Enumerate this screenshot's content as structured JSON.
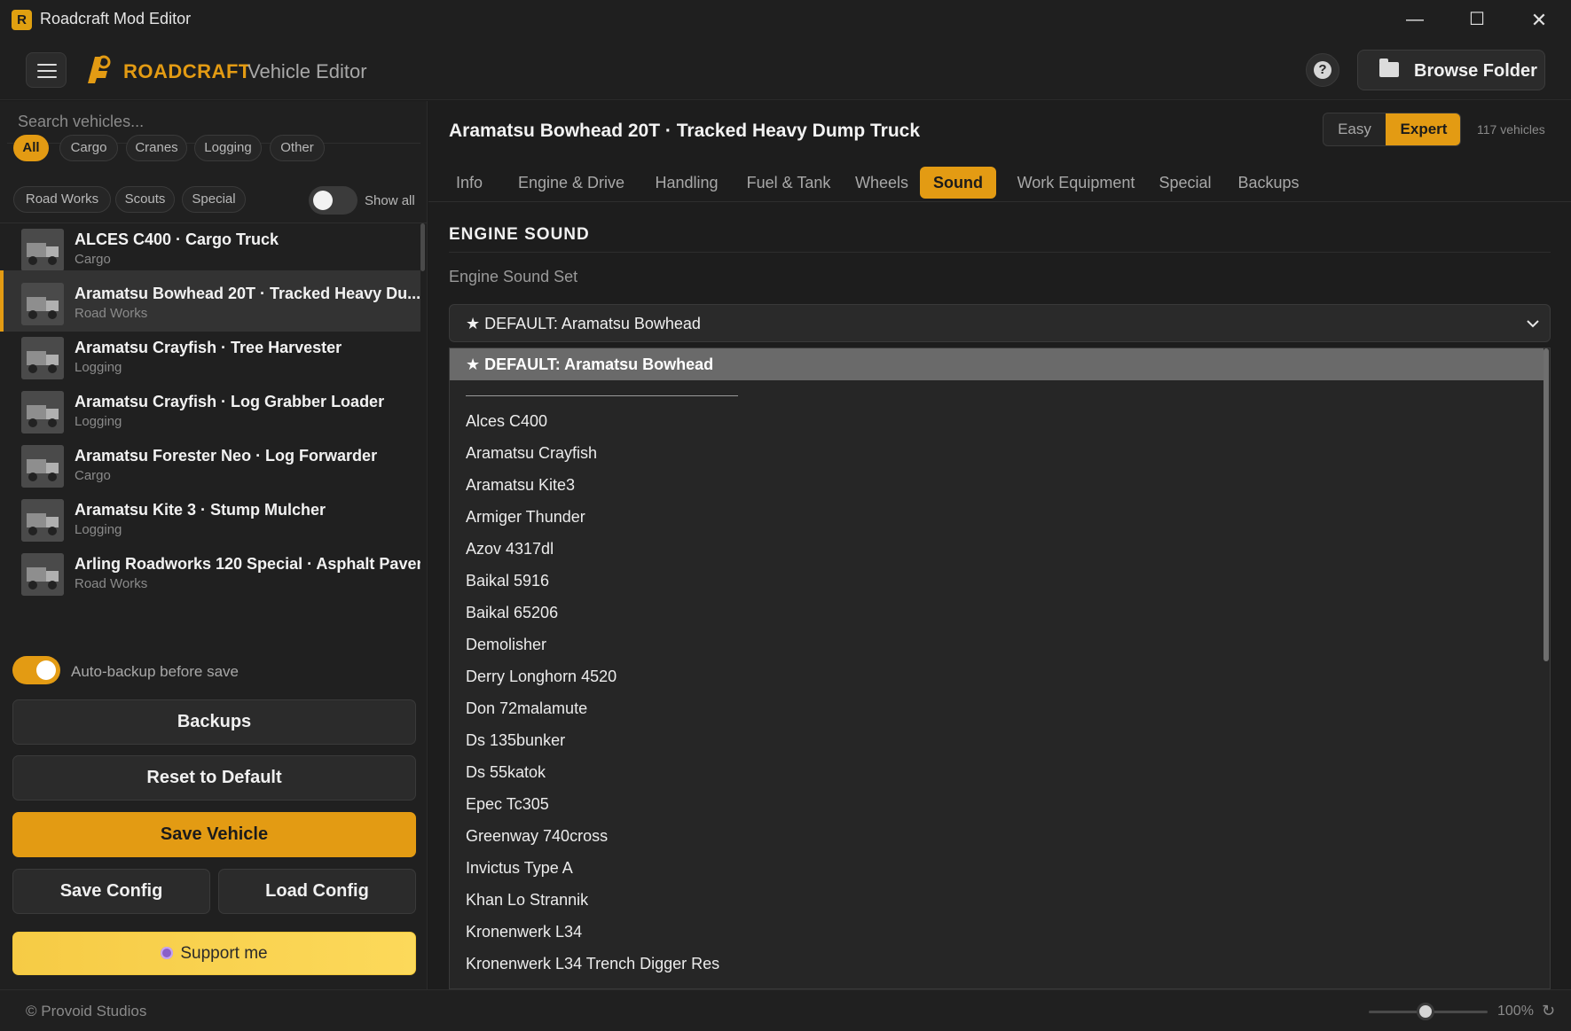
{
  "window": {
    "title": "Roadcraft Mod Editor",
    "app_icon": "R",
    "minimize": "—",
    "maximize": "☐",
    "close": "✕"
  },
  "header": {
    "brand": "ROADCRAFT",
    "subtitle": "Vehicle Editor",
    "help_label": "?",
    "browse_label": "Browse Folder"
  },
  "sidebar": {
    "search_placeholder": "Search vehicles...",
    "filters": [
      "All",
      "Cargo",
      "Cranes",
      "Logging",
      "Other",
      "Road Works",
      "Scouts",
      "Special"
    ],
    "active_filter": "All",
    "show_all_label": "Show all",
    "show_all_on": false,
    "vehicles": [
      {
        "name": "ALCES C400 · Cargo Truck",
        "category": "Cargo"
      },
      {
        "name": "Aramatsu Bowhead 20T · Tracked Heavy Du...",
        "category": "Road Works",
        "selected": true
      },
      {
        "name": "Aramatsu Crayfish · Tree Harvester",
        "category": "Logging"
      },
      {
        "name": "Aramatsu Crayfish · Log Grabber Loader",
        "category": "Logging"
      },
      {
        "name": "Aramatsu Forester Neo · Log Forwarder",
        "category": "Cargo"
      },
      {
        "name": "Aramatsu Kite 3 · Stump Mulcher",
        "category": "Logging"
      },
      {
        "name": "Arling Roadworks 120 Special · Asphalt Paver",
        "category": "Road Works"
      }
    ],
    "autobackup_label": "Auto-backup before save",
    "autobackup_on": true,
    "buttons": {
      "backups": "Backups",
      "reset": "Reset to Default",
      "save": "Save Vehicle",
      "save_config": "Save Config",
      "load_config": "Load Config",
      "support": "Support me"
    }
  },
  "main": {
    "vehicle_title": "Aramatsu Bowhead 20T · Tracked Heavy Dump Truck",
    "mode": {
      "easy": "Easy",
      "expert": "Expert",
      "active": "Expert"
    },
    "vehicle_count": "117 vehicles",
    "tabs": [
      "Info",
      "Engine & Drive",
      "Handling",
      "Fuel & Tank",
      "Wheels",
      "Sound",
      "Work Equipment",
      "Special",
      "Backups"
    ],
    "active_tab": "Sound",
    "section_heading": "ENGINE SOUND",
    "sound_set_label": "Engine Sound Set",
    "sound_set_value": "★ DEFAULT: Aramatsu Bowhead",
    "dropdown": {
      "highlighted": "★ DEFAULT: Aramatsu Bowhead",
      "options": [
        "Alces C400",
        "Aramatsu Crayfish",
        "Aramatsu Kite3",
        "Armiger Thunder",
        "Azov 4317dl",
        "Baikal 5916",
        "Baikal 65206",
        "Demolisher",
        "Derry Longhorn 4520",
        "Don 72malamute",
        "Ds 135bunker",
        "Ds 55katok",
        "Epec Tc305",
        "Greenway 740cross",
        "Invictus Type A",
        "Khan Lo Strannik",
        "Kronenwerk L34",
        "Kronenwerk L34 Trench Digger Res"
      ]
    }
  },
  "statusbar": {
    "copyright": "© Provoid Studios",
    "zoom": "100%",
    "zoom_level": 0.5,
    "reset_icon": "↻"
  },
  "colors": {
    "accent": "#e39b13",
    "background": "#1b1b1b",
    "panel": "#202020",
    "support": "#f6cb45"
  }
}
